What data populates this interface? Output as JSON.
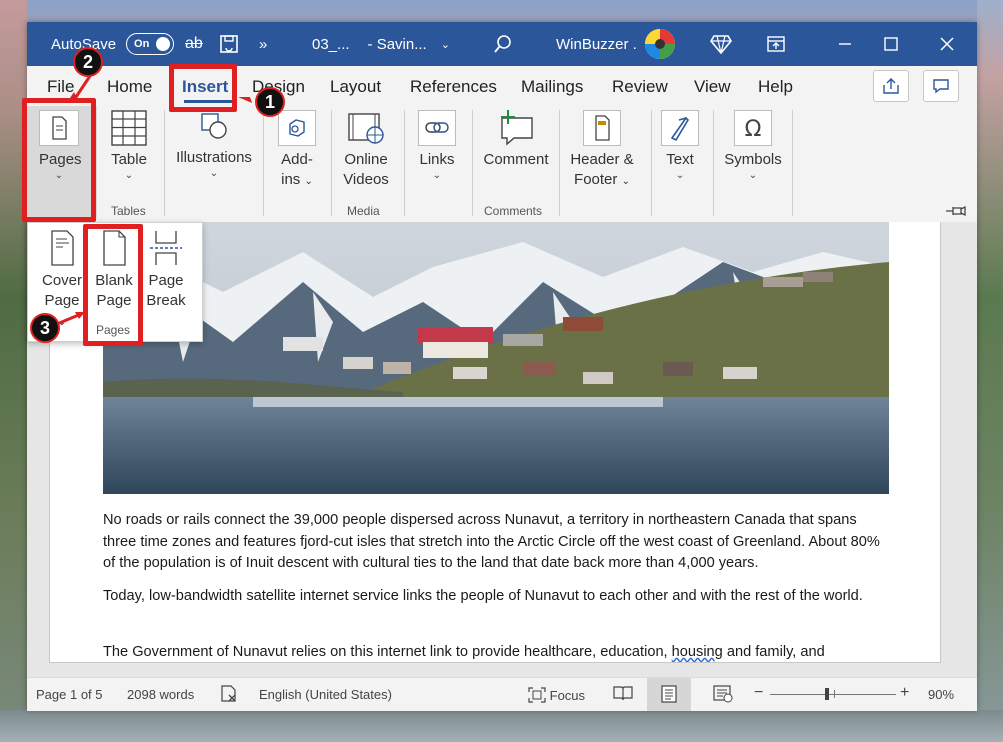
{
  "titlebar": {
    "autosave_label": "AutoSave",
    "autosave_state": "On",
    "doc_name": "03_...",
    "saving_status": "-  Savin...",
    "account_name": "WinBuzzer ."
  },
  "menu": {
    "tabs": [
      "File",
      "Home",
      "Insert",
      "Design",
      "Layout",
      "References",
      "Mailings",
      "Review",
      "View",
      "Help"
    ],
    "active_tab": "Insert"
  },
  "ribbon": {
    "pages": "Pages",
    "table": "Table",
    "illustrations": "Illustrations",
    "addins_line1": "Add-",
    "addins_line2": "ins",
    "online_videos_line1": "Online",
    "online_videos_line2": "Videos",
    "links": "Links",
    "comment": "Comment",
    "header_footer_line1": "Header &",
    "header_footer_line2": "Footer",
    "text": "Text",
    "symbols": "Symbols",
    "groups": {
      "tables": "Tables",
      "media": "Media",
      "comments": "Comments"
    }
  },
  "pages_dropdown": {
    "cover_page_line1": "Cover",
    "cover_page_line2": "Page",
    "blank_page_line1": "Blank",
    "blank_page_line2": "Page",
    "page_break_line1": "Page",
    "page_break_line2": "Break",
    "group_label": "Pages"
  },
  "document": {
    "paragraph1": "No roads or rails connect the 39,000 people dispersed across Nunavut, a territory in northeastern Canada that spans three time zones and features fjord-cut isles that stretch into the Arctic Circle off the west coast of Greenland. About 80% of the population is of Inuit descent with cultural ties to the land that date back more than 4,000 years.",
    "paragraph2": "Today, low-bandwidth satellite internet service links the people of Nunavut to each other and with the rest of the world.",
    "paragraph3_before": "The Government of Nunavut relies on this internet link to provide healthcare, education, ",
    "paragraph3_underlined": "housing",
    "paragraph3_after": " and family, and"
  },
  "statusbar": {
    "page": "Page 1 of 5",
    "words": "2098 words",
    "language": "English (United States)",
    "focus": "Focus",
    "zoom_minus": "−",
    "zoom_plus": "+",
    "zoom": "90%"
  },
  "annotations": [
    "1",
    "2",
    "3"
  ],
  "colors": {
    "word_blue": "#2b579a",
    "highlight_red": "#e02020"
  }
}
